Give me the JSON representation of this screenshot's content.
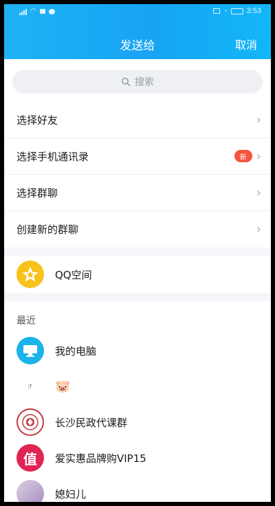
{
  "status_bar": {
    "time": "3:53"
  },
  "header": {
    "title": "发送给",
    "cancel_label": "取消"
  },
  "search": {
    "placeholder": "搜索"
  },
  "menu": [
    {
      "label": "选择好友",
      "badge": ""
    },
    {
      "label": "选择手机通讯录",
      "badge": "新"
    },
    {
      "label": "选择群聊",
      "badge": ""
    },
    {
      "label": "创建新的群聊",
      "badge": ""
    }
  ],
  "qzone": {
    "label": "QQ空间"
  },
  "recent": {
    "heading": "最近",
    "items": [
      {
        "name": "我的电脑",
        "icon": "computer-icon",
        "color": "#1ab4ea"
      },
      {
        "name": "",
        "icon": "pig-emoji",
        "color": "#f28aa0"
      },
      {
        "name": "长沙民政代课群",
        "icon": "group-seal-avatar",
        "color": "#c0393f"
      },
      {
        "name": "爱实惠品牌购VIP15",
        "icon": "value-avatar",
        "color": "#e02454"
      },
      {
        "name": "媳妇儿",
        "icon": "contact-avatar",
        "color": "#b79ec8"
      }
    ]
  },
  "colors": {
    "header": "#1aaaf5",
    "badge": "#f4533d",
    "qzone": "#f8c21a"
  }
}
